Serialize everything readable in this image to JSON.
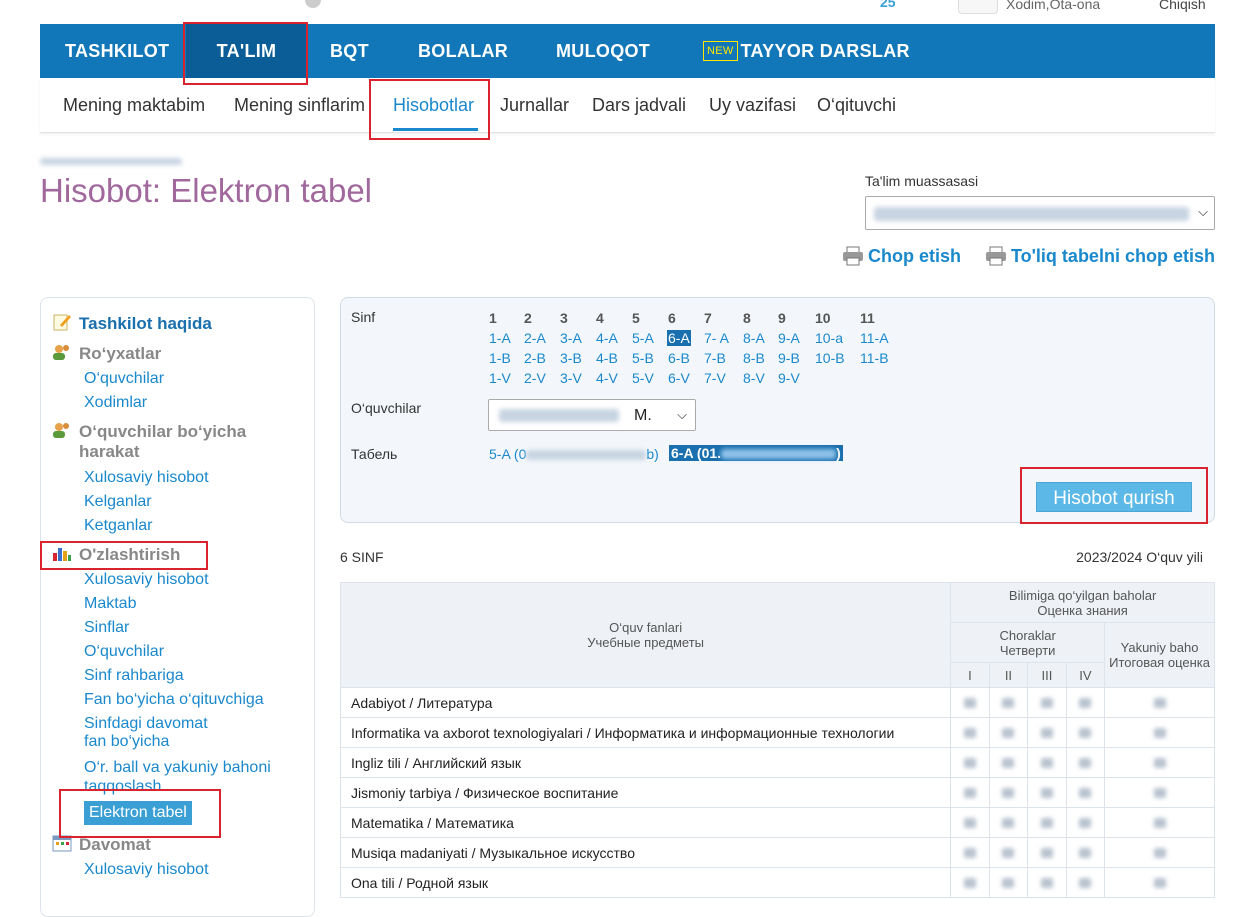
{
  "topbar": {
    "counter": "25",
    "role": "Xodim,Ota-ona",
    "logout": "Chiqish"
  },
  "nav": {
    "items": [
      "TASHKILOT",
      "TA'LIM",
      "BQT",
      "BOLALAR",
      "MULOQOT",
      "TAYYOR DARSLAR"
    ],
    "new_badge": "NEW",
    "active": "TA'LIM"
  },
  "subnav": {
    "items": [
      "Mening maktabim",
      "Mening sinflarim",
      "Hisobotlar",
      "Jurnallar",
      "Dars jadvali",
      "Uy vazifasi",
      "O‘qituvchi"
    ],
    "active": "Hisobotlar"
  },
  "page": {
    "title": "Hisobot: Elektron tabel",
    "institution_label": "Ta'lim muassasasi",
    "print": "Chop etish",
    "print_full": "To'liq tabelni chop etish"
  },
  "sidebar": {
    "org_about": "Tashkilot haqida",
    "lists": "Ro‘yxatlar",
    "lists_students": "O‘quvchilar",
    "lists_staff": "Xodimlar",
    "movement": "O‘quvchilar bo‘yicha harakat",
    "movement_summary": "Xulosaviy hisobot",
    "movement_arrived": "Kelganlar",
    "movement_left": "Ketganlar",
    "mastery": "O'zlashtirish",
    "mastery_summary": "Xulosaviy hisobot",
    "mastery_school": "Maktab",
    "mastery_classes": "Sinflar",
    "mastery_students": "O‘quvchilar",
    "mastery_class_head": "Sinf rahbariga",
    "mastery_subject_teacher": "Fan bo‘yicha o‘qituvchiga",
    "mastery_attendance_1": "Sinfdagi davomat",
    "mastery_attendance_2": "fan bo‘yicha",
    "mastery_compare_1": "O‘r. ball va yakuniy bahoni",
    "mastery_compare_2": "taqqoslash",
    "mastery_etabel": "Elektron tabel",
    "attendance": "Davomat",
    "attendance_summary": "Xulosaviy hisobot"
  },
  "filter": {
    "class_label": "Sinf",
    "students_label": "O‘quvchilar",
    "tabel_label": "Табель",
    "grades": [
      "1",
      "2",
      "3",
      "4",
      "5",
      "6",
      "7",
      "8",
      "9",
      "10",
      "11"
    ],
    "classes": [
      [
        "1-A",
        "1-B",
        "1-V"
      ],
      [
        "2-A",
        "2-B",
        "2-V"
      ],
      [
        "3-A",
        "3-B",
        "3-V"
      ],
      [
        "4-A",
        "4-B",
        "4-V"
      ],
      [
        "5-A",
        "5-B",
        "5-V"
      ],
      [
        "6-A",
        "6-B",
        "6-V"
      ],
      [
        "7- A",
        "7-B",
        "7-V"
      ],
      [
        "8-A",
        "8-B",
        "8-V"
      ],
      [
        "9-A",
        "9-B",
        "9-V"
      ],
      [
        "10-a",
        "10-B"
      ],
      [
        "11-A",
        "11-B"
      ]
    ],
    "active_class": "6-A",
    "student_initial": "M.",
    "tabel_prev_start": "5-A (0",
    "tabel_prev_end": "b)",
    "tabel_curr_start": "6-A (01.",
    "tabel_curr_end": ")",
    "build_button": "Hisobot qurish"
  },
  "report": {
    "grade": "6 SINF",
    "year": "2023/2024 O‘quv yili",
    "col_subjects_1": "O‘quv fanlari",
    "col_subjects_2": "Учебные предметы",
    "col_grades_1": "Bilimiga qo‘yilgan baholar",
    "col_grades_2": "Оценка знания",
    "col_quarters_1": "Choraklar",
    "col_quarters_2": "Четверти",
    "col_final_1": "Yakuniy baho",
    "col_final_2": "Итоговая оценка",
    "quarters": [
      "I",
      "II",
      "III",
      "IV"
    ],
    "subjects": [
      "Adabiyot / Литература",
      "Informatika va axborot texnologiyalari / Информатика и информационные технологии",
      "Ingliz tili / Английский язык",
      "Jismoniy tarbiya / Физическое воспитание",
      "Matematika / Математика",
      "Musiqa madaniyati / Музыкальное искусство",
      "Ona tili / Родной язык"
    ]
  },
  "colors": {
    "nav_bg": "#1277b8",
    "nav_active": "#0a5d96",
    "link": "#1a88cc",
    "title": "#a0689c",
    "highlight": "#d9232e"
  }
}
